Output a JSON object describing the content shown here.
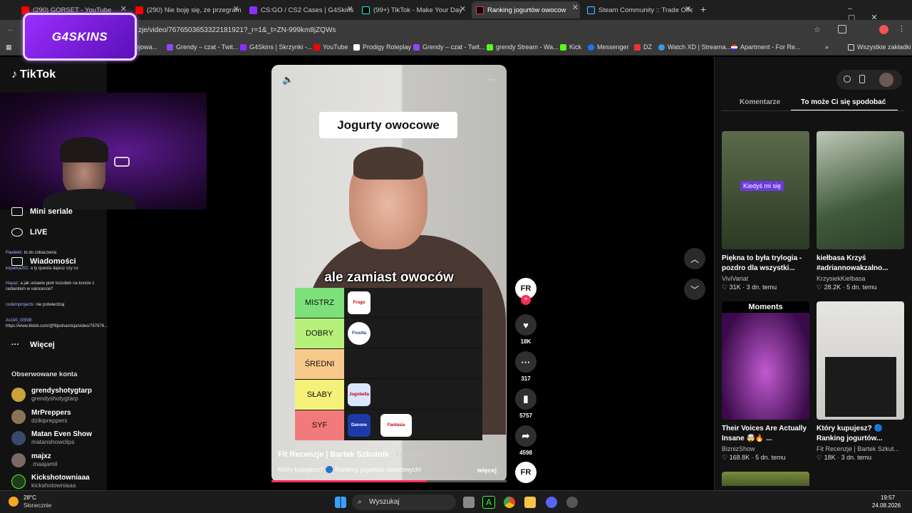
{
  "browser": {
    "tabs": [
      {
        "title": "(290) GORSET - YouTube",
        "color": "#ff0000"
      },
      {
        "title": "(290) Nie boję się, że przegram",
        "color": "#ff0000"
      },
      {
        "title": "CS:GO / CS2 Cases | G4Skins Ca",
        "color": "#8b2cff"
      },
      {
        "title": "(99+) TikTok - Make Your Day",
        "color": "#000000"
      },
      {
        "title": "Ranking jogurtów owocow",
        "color": "#000000"
      },
      {
        "title": "Steam Community :: Trade Offe",
        "color": "#1b2838"
      }
    ],
    "url": "zje/video/7676503653322181921?_r=1&_t=ZN-999km8jZQWs",
    "bookmarks": [
      "ejowa...",
      "Grendy – czat - Twit...",
      "G4Skins | Skrzynki -...",
      "YouTube",
      "Prodigy Roleplay",
      "Grendy – czat - Twit...",
      "grendy Stream - Wa...",
      "Kick",
      "Messenger",
      "DZ",
      "Watch XD | Streama...",
      "Apartment - For Re..."
    ],
    "all_bookmarks": "Wszystkie zakładki"
  },
  "overlay": {
    "logo_text": "G4SKINS"
  },
  "sidebar": {
    "brand": "TikTok",
    "nav": [
      "Mini seriale",
      "LIVE",
      "Wiadomości",
      "Więcej"
    ],
    "chat": [
      {
        "user": "Pawlekk:",
        "text": "to do zobaczenia"
      },
      {
        "user": "koparka202:",
        "text": "a ty questa dajesz czy co"
      },
      {
        "user": "Hayaz:",
        "text": "a jak ustawie piotr kozubek na koncie z radianitem w valorancie?"
      },
      {
        "user": "codeInprojects:",
        "text": "nie potwierdzaj"
      },
      {
        "user": "As1k0_G5NB:",
        "text": "https://www.tiktok.com/@fitjednamisja/video/767676..."
      }
    ],
    "followed_header": "Obserwowane konta",
    "followed": [
      {
        "name": "grendyshotygtarp",
        "handle": "grendyshotygtarp"
      },
      {
        "name": "MrPreppers",
        "handle": "dzikipreppers"
      },
      {
        "name": "Matan Even Show",
        "handle": "matanshowclips"
      },
      {
        "name": "majxz",
        "handle": ".maajamil"
      },
      {
        "name": "Kickshotowniaaa",
        "handle": "kickshotowniaaa"
      }
    ]
  },
  "video": {
    "title_card": "Jogurty owocowe",
    "subtitle": "ale zamiast owoców",
    "tiers": [
      {
        "label": "MISTRZ",
        "color": "#7ee07a"
      },
      {
        "label": "DOBRY",
        "color": "#b6f07a"
      },
      {
        "label": "ŚREDNI",
        "color": "#f7c98a"
      },
      {
        "label": "SŁABY",
        "color": "#f4f27a"
      },
      {
        "label": "SYF",
        "color": "#f37a7a"
      }
    ],
    "product_labels": [
      "Frugo",
      "Fruvita",
      "Jogobella",
      "Danone",
      "Fantasia"
    ],
    "author": "Fit Recenzje | Bartek Szkutnik",
    "age": "· 3 dn. temu",
    "description": "Który kupujesz? 🔵 Ranking jogurtów owocowych!",
    "more": "więcej",
    "progress": 0.66
  },
  "actions": {
    "avatar": "FR",
    "likes": "18K",
    "comments": "317",
    "saves": "5757",
    "shares": "4598"
  },
  "panel": {
    "tabs": [
      "Komentarze",
      "To może Ci się spodobać"
    ],
    "cards": [
      {
        "title": "Piękna to była trylogia - pozdro dla wszystki...",
        "author": "ViviVariat",
        "meta": "♡ 31K · 3 dn. temu",
        "overlay": "Kiedyś mi się"
      },
      {
        "title": "kiełbasa Krzyś #adriannowakzalno...",
        "author": "KrzysiekKielbasa",
        "meta": "♡ 28.2K · 5 dn. temu",
        "overlay": ""
      },
      {
        "title": "Their Voices Are Actually Insane 🤯🔥 ...",
        "author": "BiznizShow",
        "meta": "♡ 168.8K · 5 dn. temu",
        "overlay": "Moments"
      },
      {
        "title": "Który kupujesz? 🔵 Ranking jogurtów...",
        "author": "Fit Recenzje | Bartek Szkut...",
        "meta": "♡ 18K · 3 dn. temu",
        "overlay": ""
      }
    ]
  },
  "taskbar": {
    "weather_temp": "28°C",
    "weather_desc": "Słonecznie",
    "search": "Wyszukaj",
    "time": "19:57",
    "date": "24.08.2026"
  },
  "colors": {
    "tiktok_red": "#fe2c55",
    "accent_purple": "#8b2cff"
  }
}
